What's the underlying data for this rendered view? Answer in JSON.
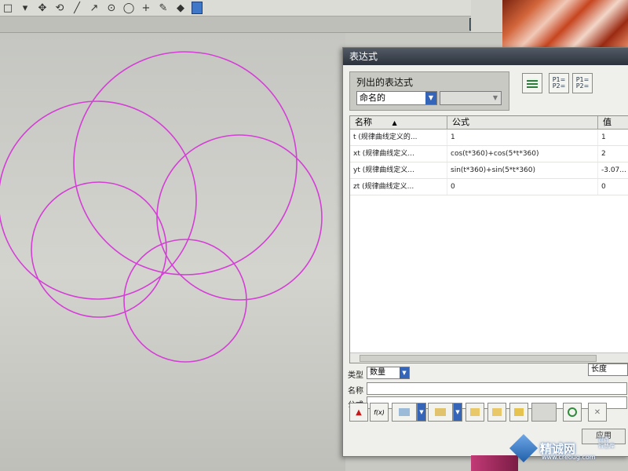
{
  "toolbar": {
    "icons": [
      "select-rect-icon",
      "dropdown-icon",
      "move-icon",
      "rotate-icon",
      "line-icon",
      "arc-icon",
      "circle-point-icon",
      "circle-icon",
      "cross-icon",
      "pen-icon",
      "shape-icon",
      "book-icon"
    ],
    "glyphs": [
      "□",
      "▾",
      "✥",
      "⟲",
      "╱",
      "↗",
      "⊙",
      "◯",
      "+",
      "✎",
      "◆",
      "▮"
    ]
  },
  "dialog": {
    "title": "表达式",
    "group_label": "列出的表达式",
    "filter_select": "命名的",
    "filter_select2": "",
    "icon_labels": [
      "",
      "P1=\nP2=",
      "P1=\nP2="
    ],
    "table": {
      "headers": [
        "名称",
        "▲",
        "公式",
        "值"
      ],
      "rows": [
        {
          "name": "t  (规律曲线定义的...",
          "formula": "1",
          "value": "1"
        },
        {
          "name": "xt  (规律曲线定义...",
          "formula": "cos(t*360)+cos(5*t*360)",
          "value": "2"
        },
        {
          "name": "yt  (规律曲线定义...",
          "formula": "sin(t*360)+sin(5*t*360)",
          "value": "-3.07..."
        },
        {
          "name": "zt  (规律曲线定义...",
          "formula": "0",
          "value": "0"
        }
      ]
    },
    "type_label": "类型",
    "type_value": "数量",
    "unit_value": "长度",
    "name_label": "名称",
    "formula_label": "公式",
    "name_value": "",
    "formula_value": "",
    "bottom_buttons": [
      "▲",
      "f(x)",
      "",
      "",
      "",
      "",
      "",
      "",
      "",
      "✕"
    ],
    "apply_label": "应用"
  },
  "watermark": {
    "brand": "精诚网",
    "url": "www.creoug.com",
    "sub": "设计\n智慧库"
  },
  "colors": {
    "curve": "#d43fd6",
    "accent": "#3565b8"
  }
}
